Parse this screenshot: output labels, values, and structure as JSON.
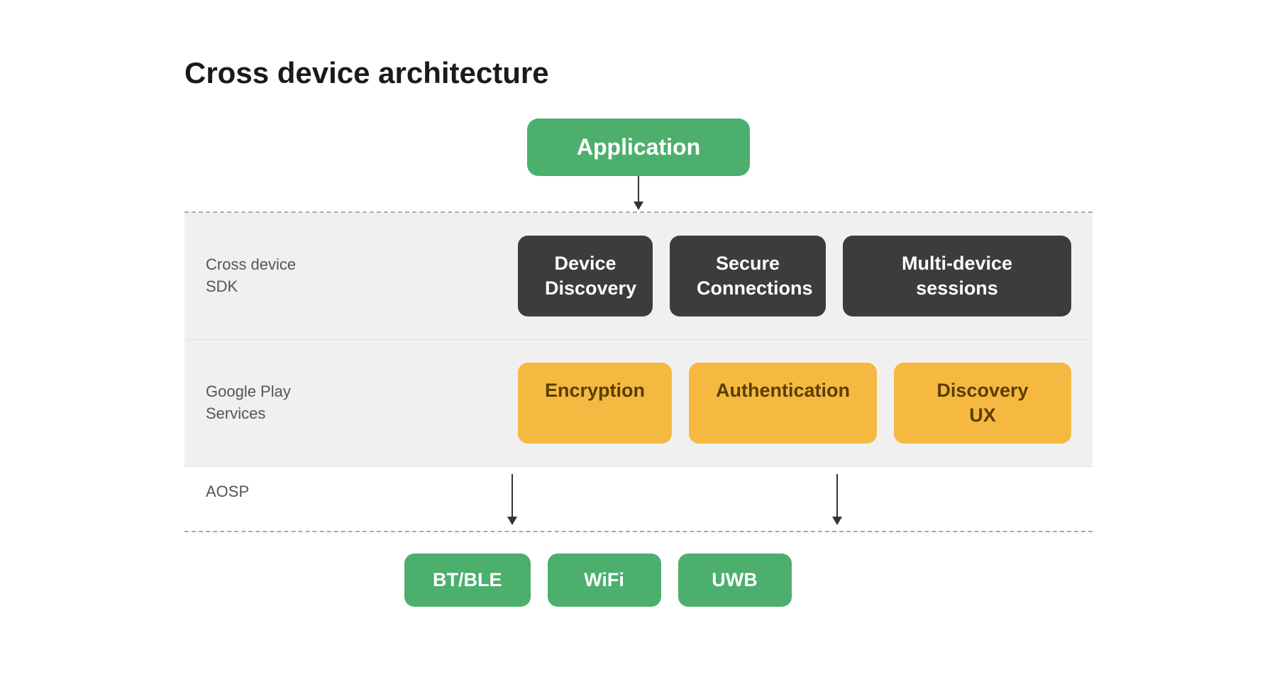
{
  "title": "Cross device architecture",
  "application_box": "Application",
  "cross_device_sdk_label": "Cross device\nSDK",
  "google_play_label": "Google Play\nServices",
  "aosp_label": "AOSP",
  "sdk_boxes": [
    {
      "label": "Device\nDiscovery"
    },
    {
      "label": "Secure\nConnections"
    },
    {
      "label": "Multi-device sessions"
    }
  ],
  "gps_boxes": [
    {
      "label": "Encryption"
    },
    {
      "label": "Authentication"
    },
    {
      "label": "Discovery UX"
    }
  ],
  "bottom_boxes": [
    {
      "label": "BT/BLE"
    },
    {
      "label": "WiFi"
    },
    {
      "label": "UWB"
    }
  ],
  "colors": {
    "green": "#4caf6e",
    "dark": "#3c3c3c",
    "yellow": "#f5b942",
    "arrow": "#333333",
    "dashed": "#aaaaaa",
    "band_bg": "#f0f0f0",
    "label": "#555555"
  }
}
